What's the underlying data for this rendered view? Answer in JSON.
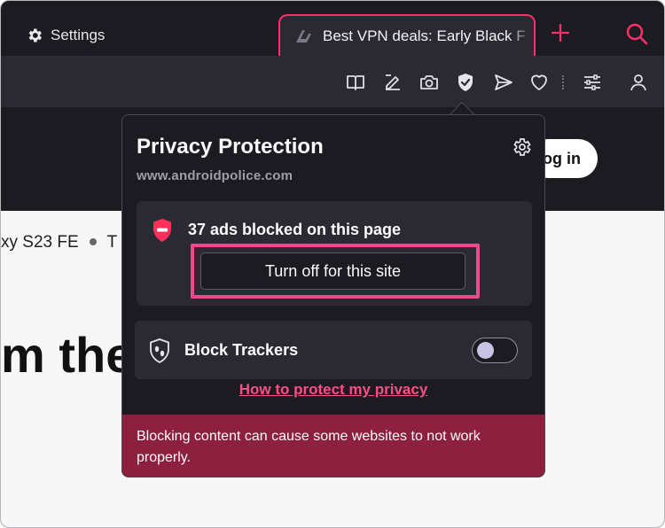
{
  "tabs": {
    "settings_label": "Settings",
    "active_title": "Best VPN deals: Early Black F"
  },
  "page": {
    "login_label": "og in",
    "breadcrumb_part1": "xy S23 FE",
    "breadcrumb_part2": "T",
    "headline": "m the"
  },
  "popup": {
    "title": "Privacy Protection",
    "site": "www.androidpolice.com",
    "ads_blocked_text": "37 ads blocked on this page",
    "turn_off_label": "Turn off for this site",
    "block_trackers_label": "Block Trackers",
    "block_trackers_enabled": false,
    "privacy_link": "How to protect my privacy",
    "warning": "Blocking content can cause some websites to not work properly."
  },
  "colors": {
    "accent": "#ff2f6b",
    "link": "#ff4d86",
    "warning_bg": "#8d1f3f",
    "highlight": "#f0488c"
  },
  "icons": {
    "toolbar": [
      "reader-icon",
      "edit-icon",
      "camera-icon",
      "shield-check-icon",
      "send-icon",
      "heart-icon",
      "sliders-icon",
      "profile-icon"
    ]
  }
}
